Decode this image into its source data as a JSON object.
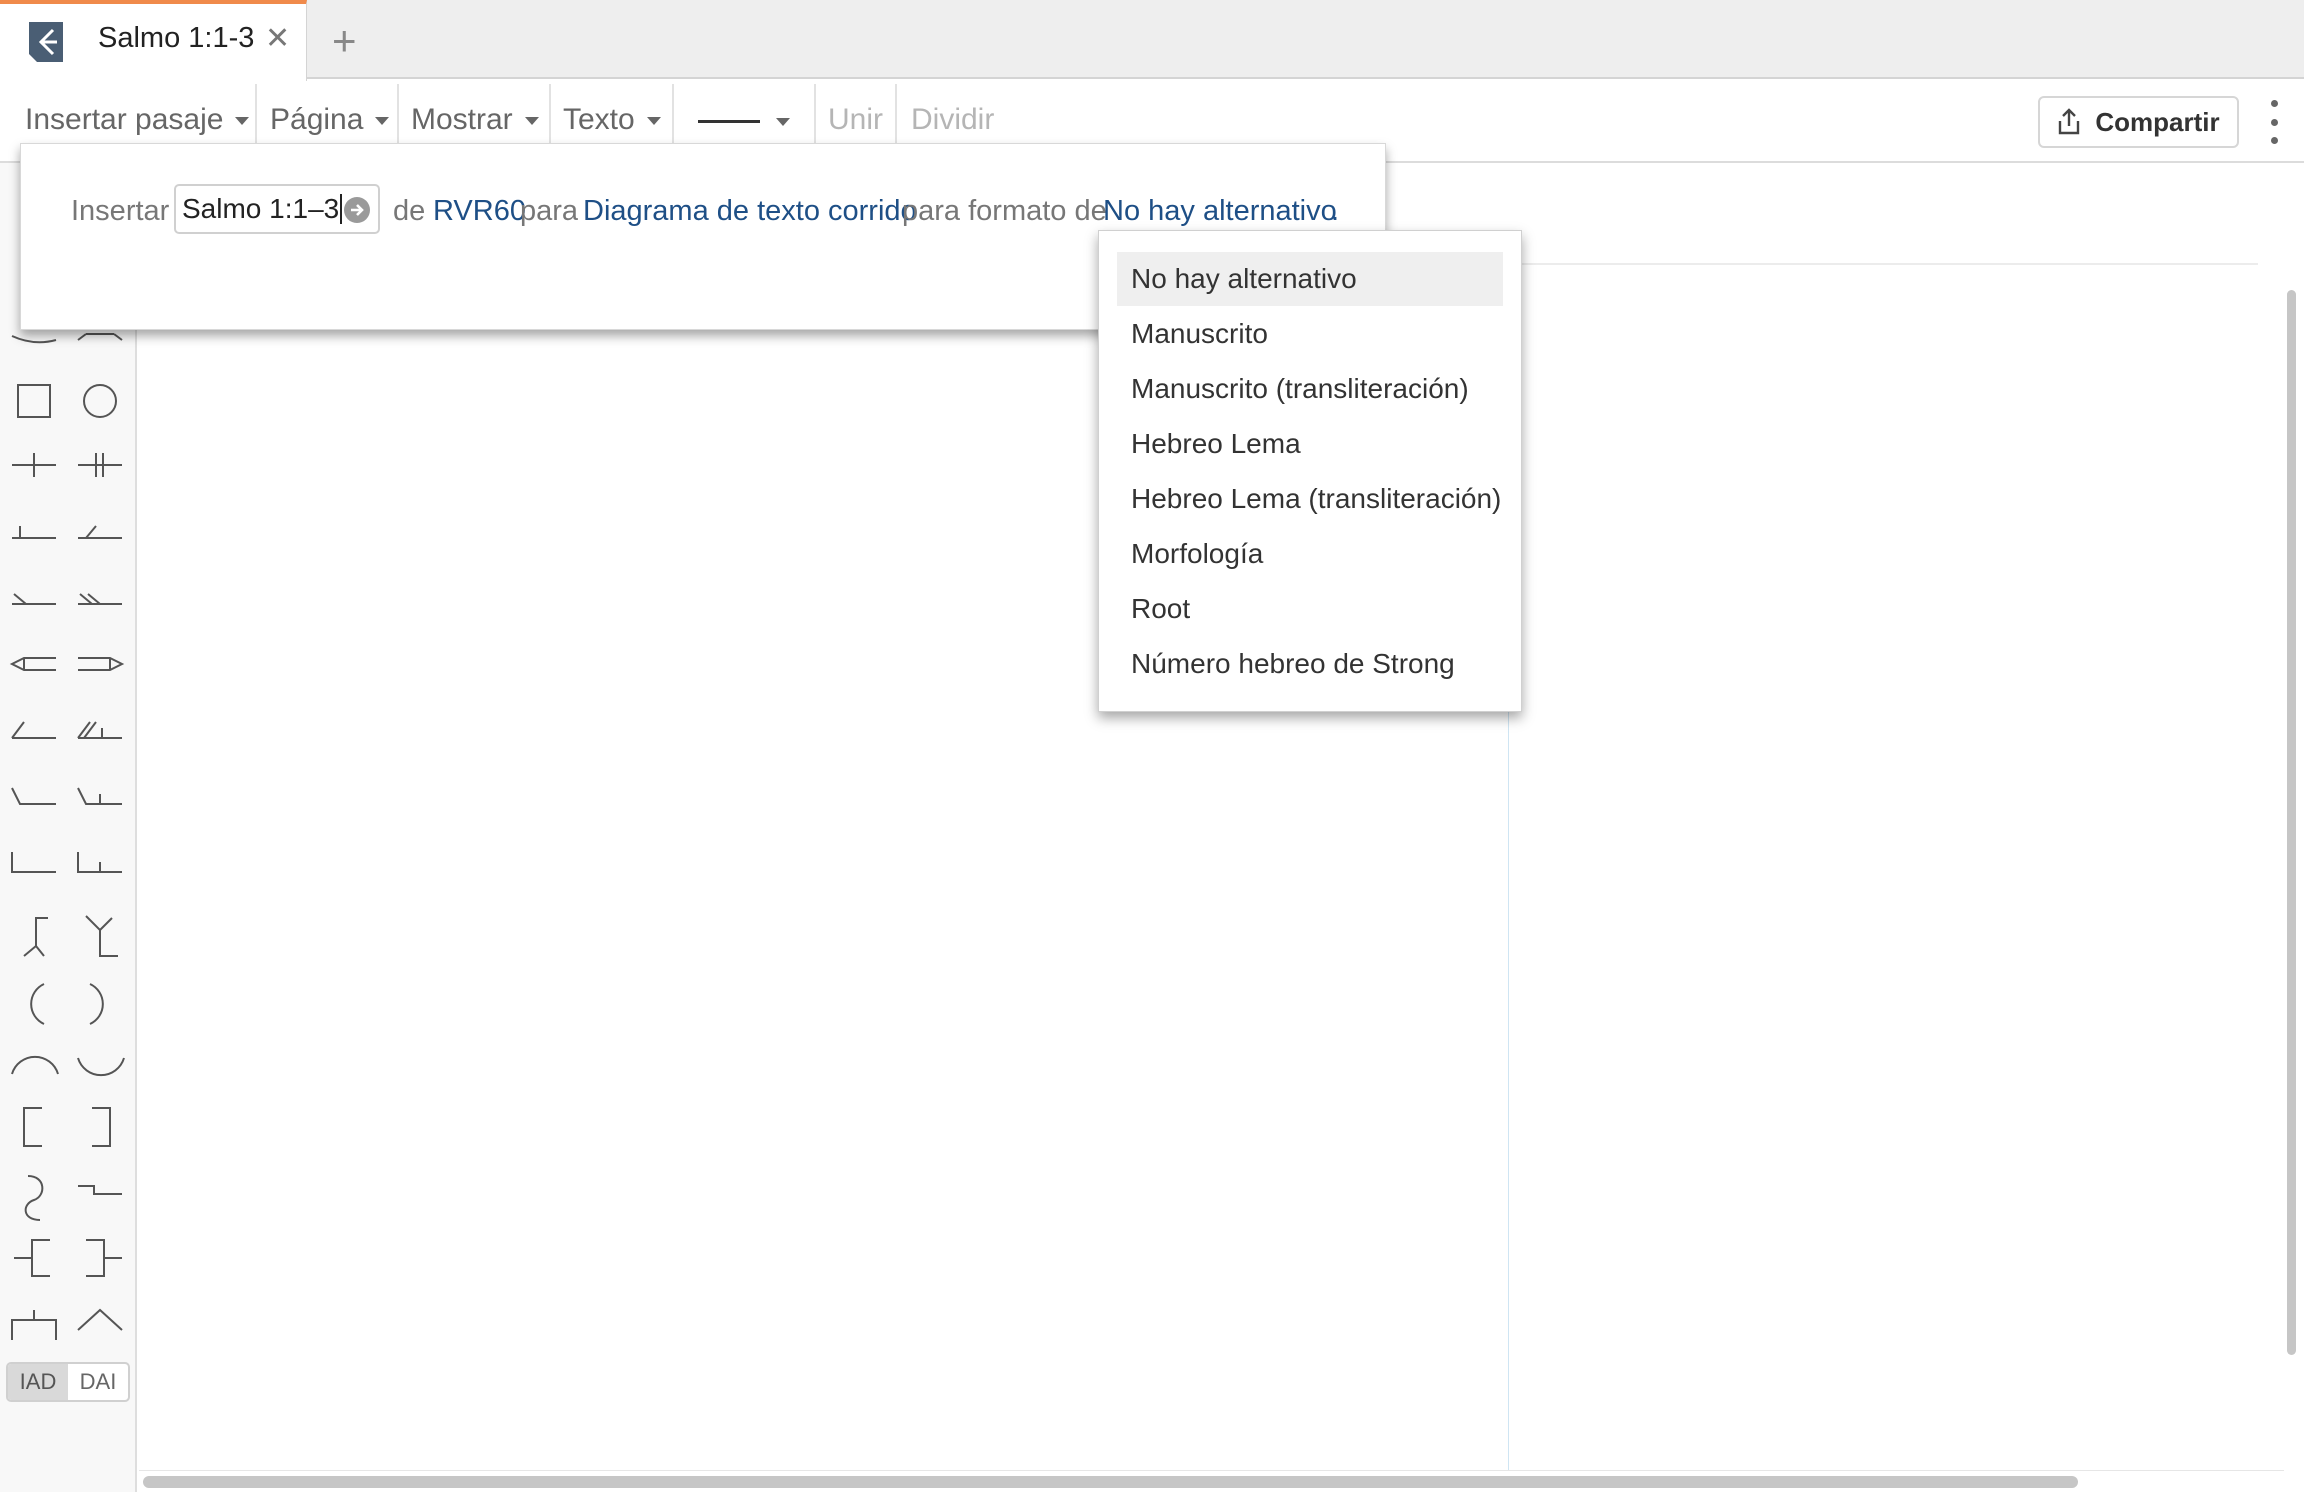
{
  "tab": {
    "title": "Salmo 1:1-3",
    "close_glyph": "✕",
    "new_tab_glyph": "+"
  },
  "toolbar": {
    "insert_passage": "Insertar pasaje",
    "page": "Página",
    "show": "Mostrar",
    "text": "Texto",
    "join": "Unir",
    "split": "Dividir",
    "share": "Compartir"
  },
  "insert_panel": {
    "insert_label": "Insertar",
    "passage_value": "Salmo 1:1–3",
    "de": "de",
    "version": "RVR60",
    "para": "para",
    "diagram_type": "Diagrama de texto corrido",
    "format_label": "para formato de",
    "format_value": "No hay alternativo",
    "period": "."
  },
  "dropdown": {
    "items": [
      {
        "label": "No hay alternativo",
        "selected": true
      },
      {
        "label": "Manuscrito"
      },
      {
        "label": "Manuscrito (transliteración)"
      },
      {
        "label": "Hebreo Lema"
      },
      {
        "label": "Hebreo Lema (transliteración)"
      },
      {
        "label": "Morfología"
      },
      {
        "label": "Root"
      },
      {
        "label": "Número hebreo de Strong"
      }
    ]
  },
  "palette": {
    "toggle": [
      "IAD",
      "DAI"
    ],
    "active": "IAD"
  },
  "icons": [
    "app-diagram-icon",
    "close-icon",
    "plus-icon",
    "caret-down-icon",
    "share-icon",
    "more-vertical-icon",
    "go-arrow-icon"
  ],
  "colors": {
    "accent_tab": "#f08a4b",
    "link": "#1e4f86"
  }
}
